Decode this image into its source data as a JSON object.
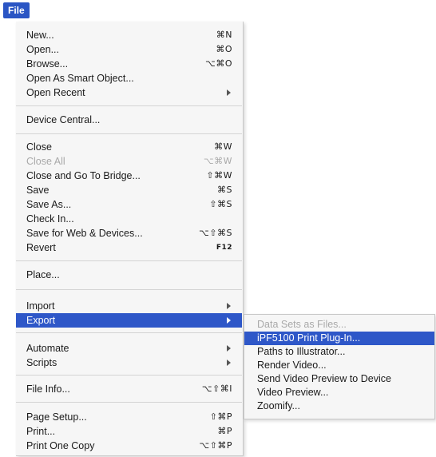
{
  "menubar": {
    "title": "File"
  },
  "menu": {
    "new": {
      "label": "New...",
      "shortcut": "⌘N"
    },
    "open": {
      "label": "Open...",
      "shortcut": "⌘O"
    },
    "browse": {
      "label": "Browse...",
      "shortcut": "⌥⌘O"
    },
    "open_smart": {
      "label": "Open As Smart Object..."
    },
    "open_recent": {
      "label": "Open Recent"
    },
    "device_central": {
      "label": "Device Central..."
    },
    "close": {
      "label": "Close",
      "shortcut": "⌘W"
    },
    "close_all": {
      "label": "Close All",
      "shortcut": "⌥⌘W"
    },
    "close_bridge": {
      "label": "Close and Go To Bridge...",
      "shortcut": "⇧⌘W"
    },
    "save": {
      "label": "Save",
      "shortcut": "⌘S"
    },
    "save_as": {
      "label": "Save As...",
      "shortcut": "⇧⌘S"
    },
    "check_in": {
      "label": "Check In..."
    },
    "save_web": {
      "label": "Save for Web & Devices...",
      "shortcut": "⌥⇧⌘S"
    },
    "revert": {
      "label": "Revert",
      "shortcut": "F12"
    },
    "place": {
      "label": "Place..."
    },
    "import": {
      "label": "Import"
    },
    "export": {
      "label": "Export"
    },
    "automate": {
      "label": "Automate"
    },
    "scripts": {
      "label": "Scripts"
    },
    "file_info": {
      "label": "File Info...",
      "shortcut": "⌥⇧⌘I"
    },
    "page_setup": {
      "label": "Page Setup...",
      "shortcut": "⇧⌘P"
    },
    "print": {
      "label": "Print...",
      "shortcut": "⌘P"
    },
    "print_one": {
      "label": "Print One Copy",
      "shortcut": "⌥⇧⌘P"
    }
  },
  "submenu": {
    "items": [
      {
        "label": "Data Sets as Files...",
        "disabled": true
      },
      {
        "label": "iPF5100 Print Plug-In...",
        "highlight": true
      },
      {
        "label": "Paths to Illustrator..."
      },
      {
        "label": "Render Video..."
      },
      {
        "label": "Send Video Preview to Device"
      },
      {
        "label": "Video Preview..."
      },
      {
        "label": "Zoomify..."
      }
    ]
  }
}
